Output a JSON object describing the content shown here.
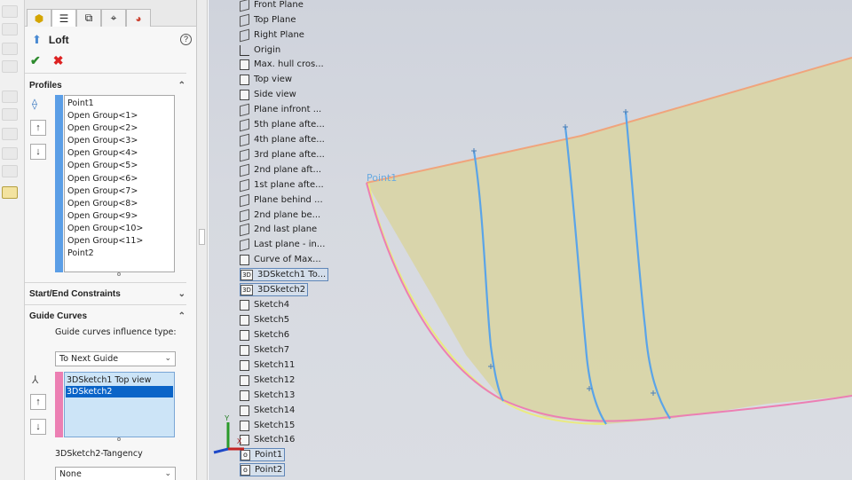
{
  "property_manager": {
    "title": "Loft",
    "help_symbol": "?",
    "profiles": {
      "header": "Profiles",
      "items": [
        "Point1",
        "Open Group<1>",
        "Open Group<2>",
        "Open Group<3>",
        "Open Group<4>",
        "Open Group<5>",
        "Open Group<6>",
        "Open Group<7>",
        "Open Group<8>",
        "Open Group<9>",
        "Open Group<10>",
        "Open Group<11>",
        "Point2"
      ],
      "color": "#5b9ee6"
    },
    "start_end": {
      "header": "Start/End Constraints"
    },
    "guide_curves": {
      "header": "Guide Curves",
      "influence_label": "Guide curves influence type:",
      "influence_value": "To Next Guide",
      "items": [
        "3DSketch1 Top view",
        "3DSketch2"
      ],
      "selected_index": 1,
      "color": "#ec7fb3",
      "tangency_label": "3DSketch2-Tangency",
      "tangency_value": "None"
    }
  },
  "feature_tree": {
    "items": [
      {
        "label": "Front Plane",
        "icon": "plane-icon"
      },
      {
        "label": "Top Plane",
        "icon": "plane-icon"
      },
      {
        "label": "Right Plane",
        "icon": "plane-icon"
      },
      {
        "label": "Origin",
        "icon": "origin-icon"
      },
      {
        "label": "Max. hull cros...",
        "icon": "sketch-icon"
      },
      {
        "label": "Top view",
        "icon": "sketch-icon"
      },
      {
        "label": "Side view",
        "icon": "sketch-icon"
      },
      {
        "label": "Plane infront ...",
        "icon": "plane-icon"
      },
      {
        "label": "5th plane afte...",
        "icon": "plane-icon"
      },
      {
        "label": "4th plane afte...",
        "icon": "plane-icon"
      },
      {
        "label": "3rd plane afte...",
        "icon": "plane-icon"
      },
      {
        "label": "2nd plane aft...",
        "icon": "plane-icon"
      },
      {
        "label": "1st plane afte...",
        "icon": "plane-icon"
      },
      {
        "label": "Plane behind ...",
        "icon": "plane-icon"
      },
      {
        "label": "2nd plane be...",
        "icon": "plane-icon"
      },
      {
        "label": "2nd last plane",
        "icon": "plane-icon"
      },
      {
        "label": "Last plane - in...",
        "icon": "plane-icon"
      },
      {
        "label": "Curve of Max...",
        "icon": "sketch-icon"
      },
      {
        "label": "3DSketch1 To...",
        "icon": "sketch3d-icon",
        "boxed": true
      },
      {
        "label": "3DSketch2",
        "icon": "sketch3d-icon",
        "boxed": true
      },
      {
        "label": "Sketch4",
        "icon": "sketch-icon"
      },
      {
        "label": "Sketch5",
        "icon": "sketch-icon"
      },
      {
        "label": "Sketch6",
        "icon": "sketch-icon"
      },
      {
        "label": "Sketch7",
        "icon": "sketch-icon"
      },
      {
        "label": "Sketch11",
        "icon": "sketch-icon"
      },
      {
        "label": "Sketch12",
        "icon": "sketch-icon"
      },
      {
        "label": "Sketch13",
        "icon": "sketch-icon"
      },
      {
        "label": "Sketch14",
        "icon": "sketch-icon"
      },
      {
        "label": "Sketch15",
        "icon": "sketch-icon"
      },
      {
        "label": "Sketch16",
        "icon": "sketch-icon"
      },
      {
        "label": "Point1",
        "icon": "point-icon",
        "boxed": true
      },
      {
        "label": "Point2",
        "icon": "point-icon",
        "boxed": true
      }
    ],
    "sketch3d_tag": "3D",
    "point_tag": "o"
  },
  "viewport": {
    "point_label": "Point1",
    "triad_y": "Y",
    "triad_x": "X",
    "surface_color": "#d9d5a8",
    "guide_color": "#ec7fb3",
    "profile_color": "#5aa4e8",
    "edge_color": "#f0a47c"
  }
}
